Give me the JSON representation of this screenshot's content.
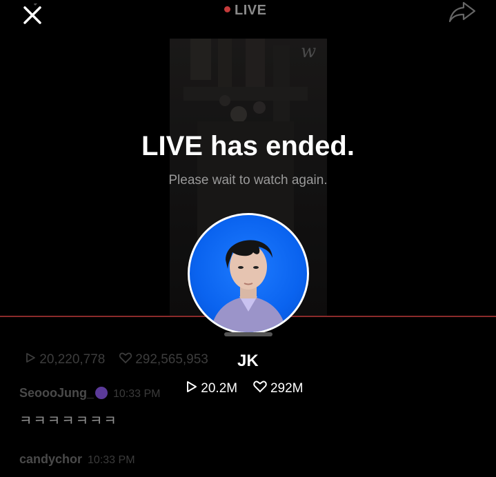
{
  "header": {
    "live_label": "LIVE",
    "close_icon": "close-icon",
    "share_icon": "share-icon"
  },
  "video": {
    "watermark": "w",
    "title": "LIVE has ended.",
    "subtitle": "Please wait to watch again."
  },
  "background_stats": {
    "views": "20,220,778",
    "likes": "292,565,953"
  },
  "profile": {
    "name": "JK",
    "views": "20.2M",
    "likes": "292M"
  },
  "comments": [
    {
      "user": "SeoooJung_",
      "time": "10:33 PM",
      "text": "ㅋㅋㅋㅋㅋㅋㅋ"
    },
    {
      "user": "candychor",
      "time": "10:33 PM"
    }
  ],
  "colors": {
    "background": "#000000",
    "live_dot": "#c53b3b",
    "avatar_bg": "#0a63ef",
    "progress": "#8c2b2b"
  }
}
